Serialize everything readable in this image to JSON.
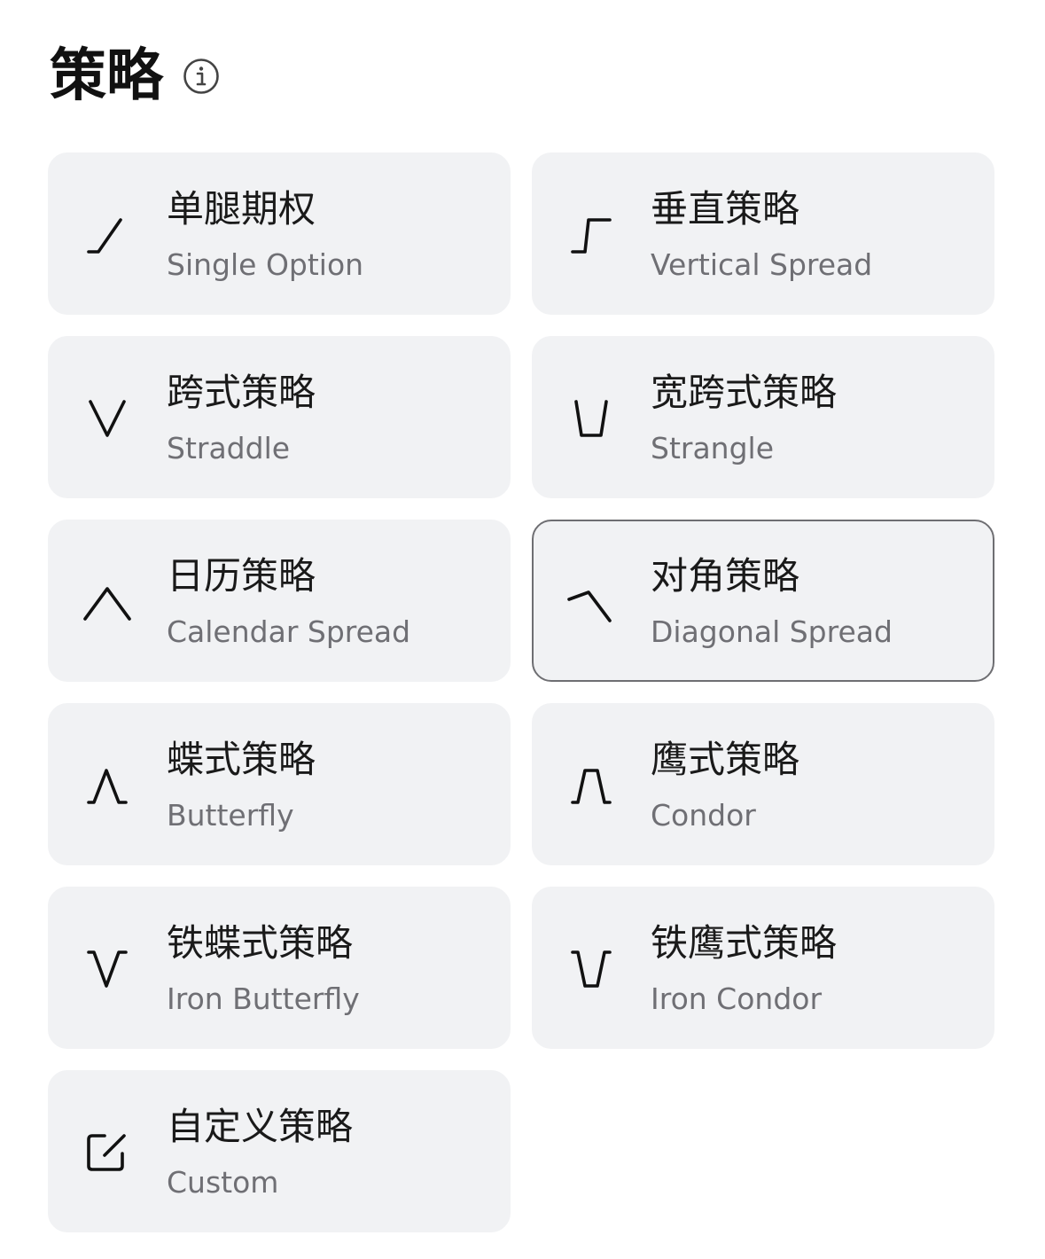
{
  "header": {
    "title": "策略",
    "info_icon": "info-icon"
  },
  "strategies": [
    {
      "zh": "单腿期权",
      "en": "Single Option",
      "icon": "single-option-icon",
      "selected": false
    },
    {
      "zh": "垂直策略",
      "en": "Vertical Spread",
      "icon": "vertical-spread-icon",
      "selected": false
    },
    {
      "zh": "跨式策略",
      "en": "Straddle",
      "icon": "straddle-icon",
      "selected": false
    },
    {
      "zh": "宽跨式策略",
      "en": "Strangle",
      "icon": "strangle-icon",
      "selected": false
    },
    {
      "zh": "日历策略",
      "en": "Calendar Spread",
      "icon": "calendar-spread-icon",
      "selected": false
    },
    {
      "zh": "对角策略",
      "en": "Diagonal Spread",
      "icon": "diagonal-spread-icon",
      "selected": true
    },
    {
      "zh": "蝶式策略",
      "en": "Butterfly",
      "icon": "butterfly-icon",
      "selected": false
    },
    {
      "zh": "鹰式策略",
      "en": "Condor",
      "icon": "condor-icon",
      "selected": false
    },
    {
      "zh": "铁蝶式策略",
      "en": "Iron Butterfly",
      "icon": "iron-butterfly-icon",
      "selected": false
    },
    {
      "zh": "铁鹰式策略",
      "en": "Iron Condor",
      "icon": "iron-condor-icon",
      "selected": false
    },
    {
      "zh": "自定义策略",
      "en": "Custom",
      "icon": "custom-edit-icon",
      "selected": false
    }
  ],
  "colors": {
    "card_bg": "#f1f2f4",
    "selected_border": "#6e6e72",
    "title_text": "#111111",
    "subtitle_text": "#6f6f74"
  }
}
